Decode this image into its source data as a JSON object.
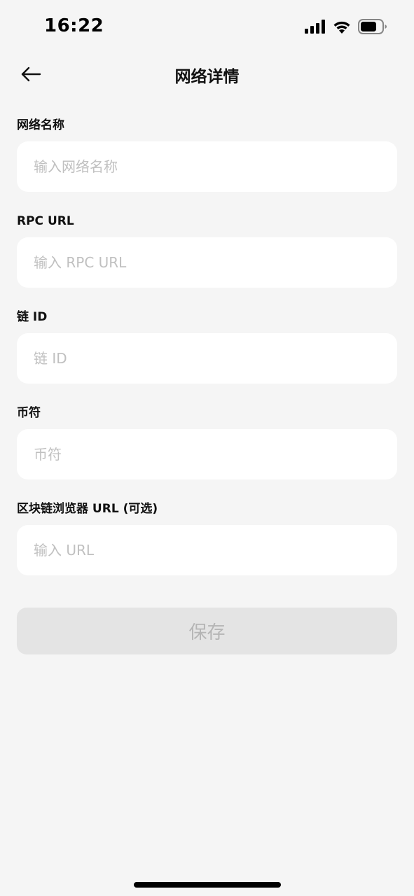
{
  "status_bar": {
    "time": "16:22",
    "icons": [
      "signal-icon",
      "wifi-icon",
      "battery-icon"
    ]
  },
  "header": {
    "title": "网络详情",
    "back_icon": "arrow-left-icon"
  },
  "form": {
    "network_name": {
      "label": "网络名称",
      "placeholder": "输入网络名称",
      "value": ""
    },
    "rpc_url": {
      "label": "RPC URL",
      "placeholder": "输入 RPC URL",
      "value": ""
    },
    "chain_id": {
      "label": "链 ID",
      "placeholder": "链 ID",
      "value": ""
    },
    "currency_symbol": {
      "label": "币符",
      "placeholder": "币符",
      "value": ""
    },
    "block_explorer_url": {
      "label": "区块链浏览器 URL (可选)",
      "placeholder": "输入 URL",
      "value": ""
    }
  },
  "save_button": {
    "label": "保存",
    "state": "disabled"
  },
  "colors": {
    "background": "#f5f5f5",
    "input_background": "#ffffff",
    "placeholder": "#c0c0c0",
    "button_disabled_bg": "#e4e4e4",
    "button_disabled_text": "#b5b5b5"
  }
}
